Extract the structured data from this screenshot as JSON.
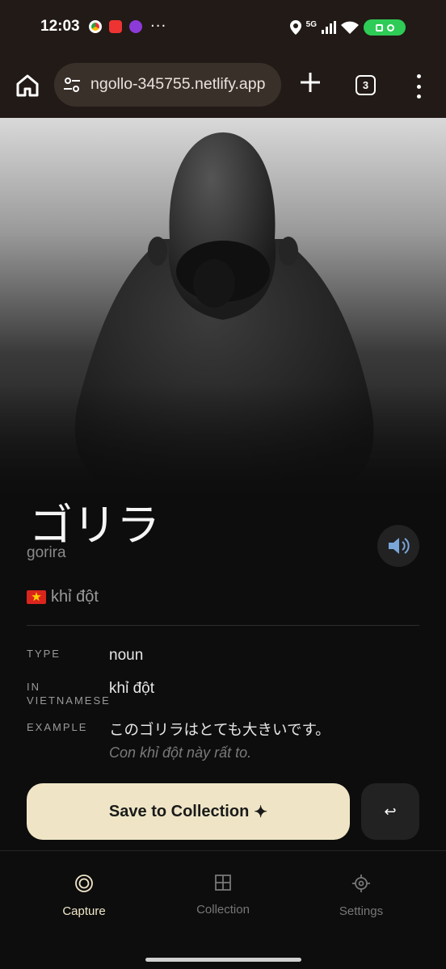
{
  "status_bar": {
    "time": "12:03",
    "dots": "···",
    "network": "5G"
  },
  "browser": {
    "url": "ngollo-345755.netlify.app",
    "tab_count": "3"
  },
  "word": {
    "japanese": "ゴリラ",
    "romaji": "gorira",
    "translation": "khỉ đột",
    "flag_icon": "vietnam-flag"
  },
  "details": {
    "type_label": "TYPE",
    "type_value": "noun",
    "in_label_1": "IN",
    "in_label_2": "VIETNAMESE",
    "in_value": "khỉ đột",
    "example_label": "EXAMPLE",
    "example_jp": "このゴリラはとても大きいです。",
    "example_vi": "Con khỉ đột này rất to."
  },
  "actions": {
    "save_label": "Save to Collection",
    "save_icon": "✦",
    "back_icon": "↩"
  },
  "nav": {
    "items": [
      {
        "label": "Capture",
        "icon": "capture-icon"
      },
      {
        "label": "Collection",
        "icon": "collection-icon"
      },
      {
        "label": "Settings",
        "icon": "settings-icon"
      }
    ],
    "active": "Capture"
  },
  "colors": {
    "accent": "#efe5c6",
    "background": "#0d0d0d",
    "browser_chrome": "#221a16"
  }
}
